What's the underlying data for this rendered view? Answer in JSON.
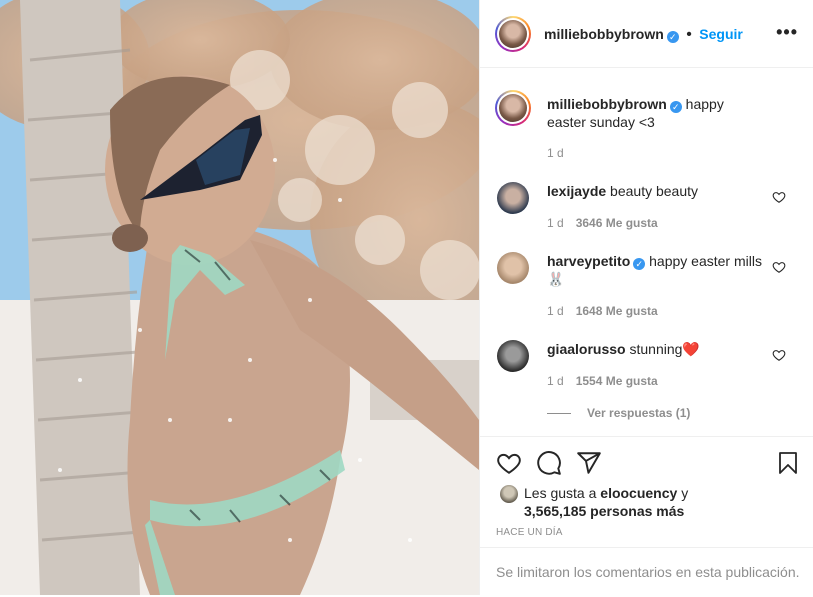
{
  "post": {
    "username": "milliebobbybrown",
    "follow_label": "Seguir",
    "more_label": "•••"
  },
  "caption": {
    "username": "milliebobbybrown",
    "text": "happy easter sunday <3",
    "time": "1 d"
  },
  "comments": [
    {
      "username": "lexijayde",
      "verified": false,
      "text": "beauty beauty",
      "time": "1 d",
      "likes": "3646 Me gusta"
    },
    {
      "username": "harveypetito",
      "verified": true,
      "text": "happy easter mills 🐰",
      "time": "1 d",
      "likes": "1648 Me gusta"
    },
    {
      "username": "giaalorusso",
      "verified": false,
      "text": "stunning❤️",
      "time": "1 d",
      "likes": "1554 Me gusta"
    }
  ],
  "view_replies": "Ver respuestas (1)",
  "likes": {
    "prefix": "Les gusta a ",
    "user": "eloocuency",
    "connector": " y",
    "count": "3,565,185 personas más"
  },
  "time_ago": "HACE UN DÍA",
  "comments_limited": "Se limitaron los comentarios en esta publicación.",
  "icons": [
    "heart-icon",
    "comment-icon",
    "share-icon",
    "bookmark-icon",
    "more-icon",
    "verified-icon"
  ],
  "colors": {
    "link": "#0095f6",
    "verified": "#3897f0",
    "muted": "#8e8e8e",
    "text": "#262626"
  }
}
